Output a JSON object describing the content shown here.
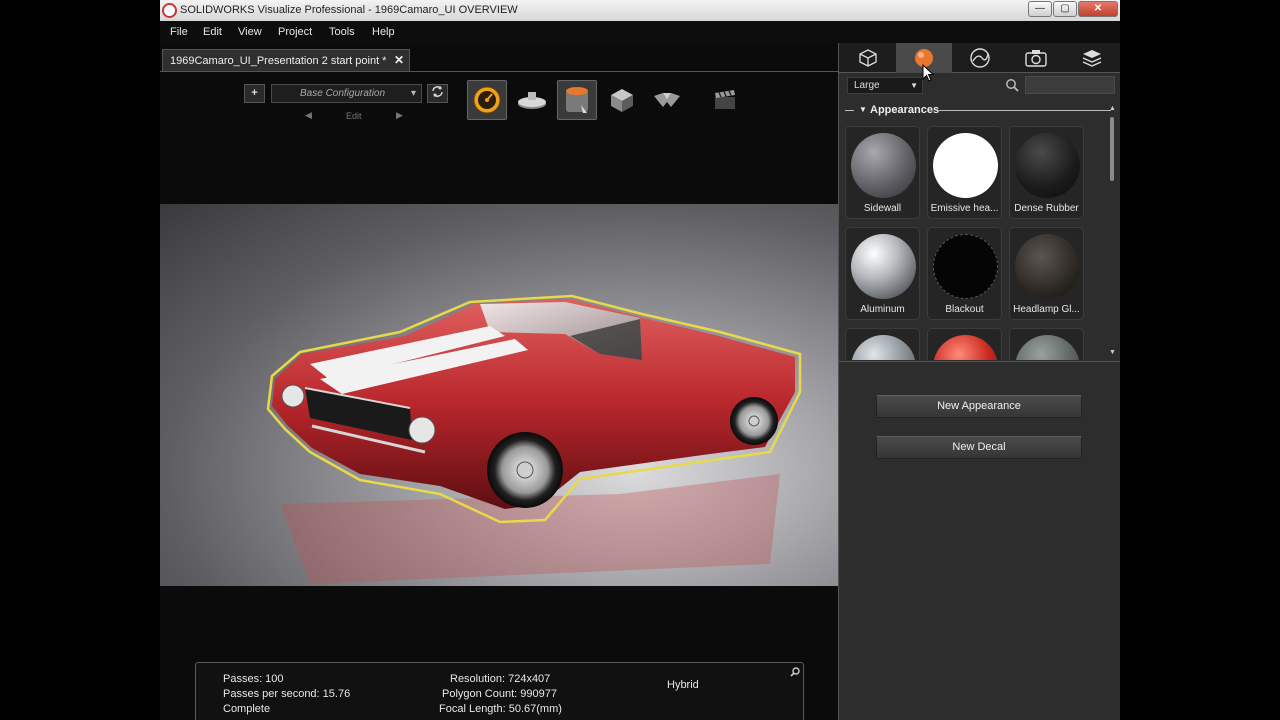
{
  "window": {
    "title": "SOLIDWORKS Visualize Professional - 1969Camaro_UI OVERVIEW",
    "controls": {
      "minimize": "—",
      "restore": "▢",
      "close": "✕"
    }
  },
  "menu": {
    "items": [
      "File",
      "Edit",
      "View",
      "Project",
      "Tools",
      "Help"
    ]
  },
  "document_tab": {
    "label": "1969Camaro_UI_Presentation 2 start point *",
    "close": "✕"
  },
  "toolbar": {
    "add": "+",
    "configuration": "Base Configuration",
    "edit_label": "Edit",
    "prev": "◀",
    "next": "▶",
    "tools": [
      "gauge-tool-icon",
      "turntable-tool-icon",
      "paint-bucket-tool-icon",
      "cube-tool-icon",
      "arrow-tool-icon",
      "clapper-tool-icon"
    ]
  },
  "status": {
    "passes": "Passes: 100",
    "passes_per_second": "Passes per second: 15.76",
    "state": "Complete",
    "resolution": "Resolution: 724x407",
    "polygon_count": "Polygon Count: 990977",
    "focal_length": "Focal Length: 50.67(mm)",
    "render_mode": "Hybrid"
  },
  "panel": {
    "tabs": [
      "models-tab-icon",
      "appearances-tab-icon",
      "scenes-tab-icon",
      "cameras-tab-icon",
      "libraries-tab-icon"
    ],
    "selected_tab": 1,
    "size": "Large",
    "search_placeholder": "",
    "section": "Appearances",
    "appearances": [
      "Sidewall",
      "Emissive hea...",
      "Dense Rubber",
      "Aluminum",
      "Blackout",
      "Headlamp Gl...",
      "",
      "",
      ""
    ],
    "buttons": {
      "new_appearance": "New Appearance",
      "new_decal": "New Decal"
    }
  },
  "colors": {
    "accent": "#e8782e",
    "selection_outline": "#e8d84a",
    "car_body": "#b8262b",
    "panel_bg": "#2d2d2d"
  }
}
